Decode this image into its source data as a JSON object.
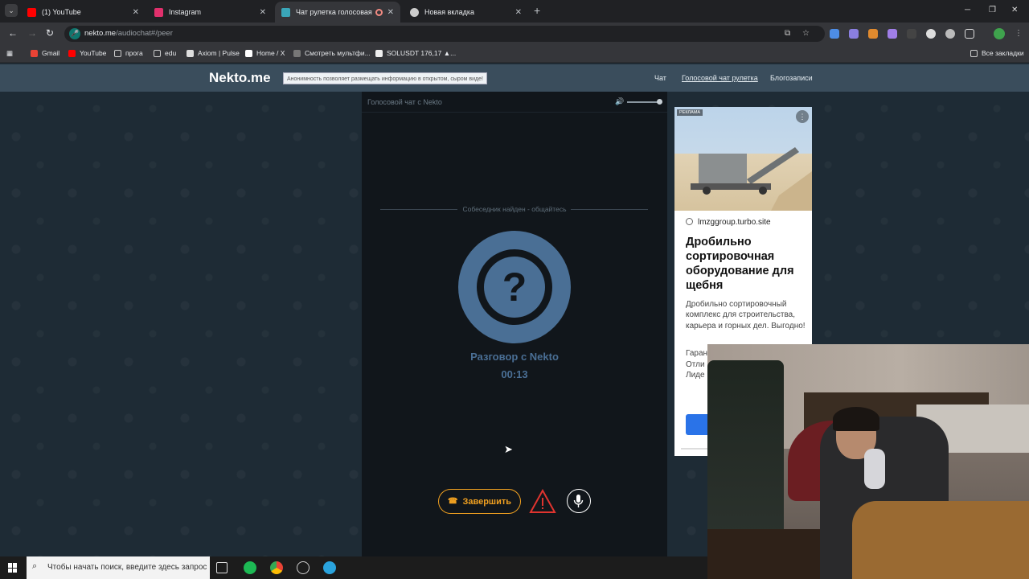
{
  "browser": {
    "tabs": [
      {
        "label": "(1) YouTube",
        "icon": "youtube-icon",
        "color": "#ff0000"
      },
      {
        "label": "Instagram",
        "icon": "instagram-icon",
        "color": "#e1306c"
      },
      {
        "label": "Чат рулетка голосовая — ",
        "icon": "nekto-icon",
        "color": "#3aa6b9",
        "active": true
      },
      {
        "label": "Новая вкладка",
        "icon": "chrome-icon",
        "color": "#cccccc"
      }
    ],
    "url_host": "nekto.me",
    "url_path": "/audiochat#/peer",
    "bookmarks": [
      {
        "label": "Gmail",
        "icon": "gmail-icon"
      },
      {
        "label": "YouTube",
        "icon": "youtube-icon"
      },
      {
        "label": "прога",
        "icon": "folder-icon"
      },
      {
        "label": "edu",
        "icon": "folder-icon"
      },
      {
        "label": "Axiom | Pulse",
        "icon": "axiom-icon"
      },
      {
        "label": "Home / X",
        "icon": "x-icon"
      },
      {
        "label": "Смотреть мультфи...",
        "icon": "film-icon"
      },
      {
        "label": "SOLUSDT 176,17 ▲...",
        "icon": "tradingview-icon"
      }
    ],
    "all_bookmarks": "Все закладки"
  },
  "site": {
    "logo": "Nekto.me",
    "tooltip": "Анонимность позволяет размещать информацию в открытом, сыром виде!",
    "nav": [
      "Чат",
      "Голосовой чат рулетка",
      "Блогозаписи"
    ]
  },
  "chat": {
    "title": "Голосовой чат с Nekto",
    "status": "Собеседник найден - общайтесь",
    "avatar_glyph": "?",
    "peer_label": "Разговор с Nekto",
    "timer": "00:13",
    "end_label": "Завершить"
  },
  "ad": {
    "tag": "РЕКЛАМА",
    "domain": "lmzggroup.turbo.site",
    "title": "Дробильно сортировочная оборудование для щебня",
    "description": "Дробильно сортировочный комплекс для строительства, карьера и горных дел. Выгодно!",
    "more": "Гаран\nОтли\nЛиде"
  },
  "taskbar": {
    "search_placeholder": "Чтобы начать поиск, введите здесь запрос"
  },
  "colors": {
    "accent": "#f0a020",
    "avatar": "#4a6f95",
    "header": "#3a4d5c"
  }
}
